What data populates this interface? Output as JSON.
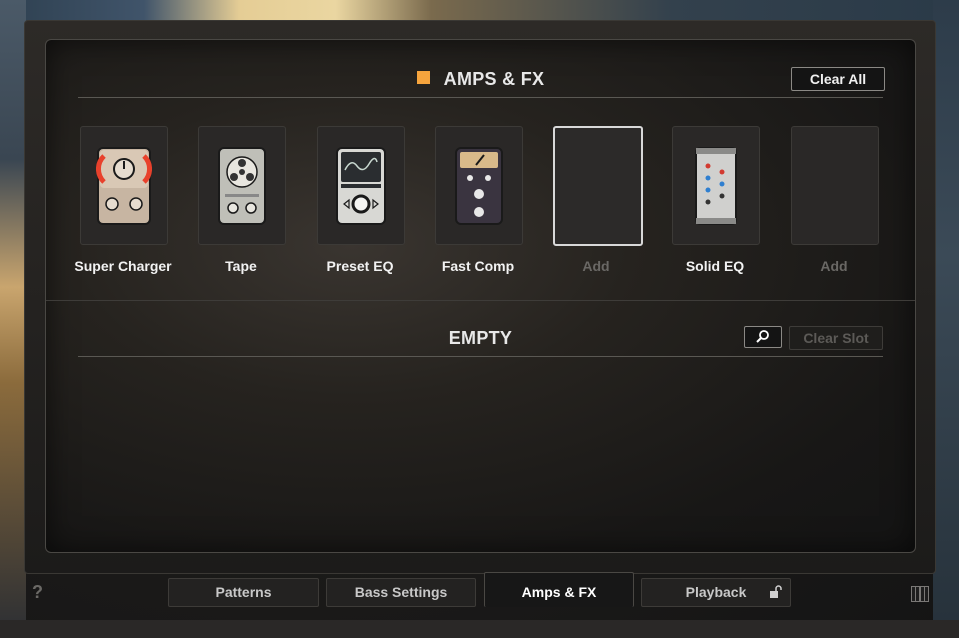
{
  "section_amps": {
    "title": "AMPS & FX",
    "clear_all": "Clear All",
    "accent_color": "#f6a43d"
  },
  "slots": [
    {
      "label": "Super Charger",
      "icon": "super-charger-pedal-icon",
      "empty": false
    },
    {
      "label": "Tape",
      "icon": "tape-pedal-icon",
      "empty": false
    },
    {
      "label": "Preset EQ",
      "icon": "preset-eq-pedal-icon",
      "empty": false
    },
    {
      "label": "Fast Comp",
      "icon": "fast-comp-pedal-icon",
      "empty": false
    },
    {
      "label": "Add",
      "icon": "",
      "empty": true,
      "selected": true
    },
    {
      "label": "Solid EQ",
      "icon": "solid-eq-pedal-icon",
      "empty": false
    },
    {
      "label": "Add",
      "icon": "",
      "empty": true
    }
  ],
  "section_slot": {
    "title": "EMPTY",
    "clear_slot": "Clear Slot"
  },
  "tabs": [
    {
      "label": "Patterns"
    },
    {
      "label": "Bass Settings"
    },
    {
      "label": "Amps & FX",
      "active": true
    },
    {
      "label": "Playback"
    }
  ],
  "footer": {
    "help": "?"
  }
}
